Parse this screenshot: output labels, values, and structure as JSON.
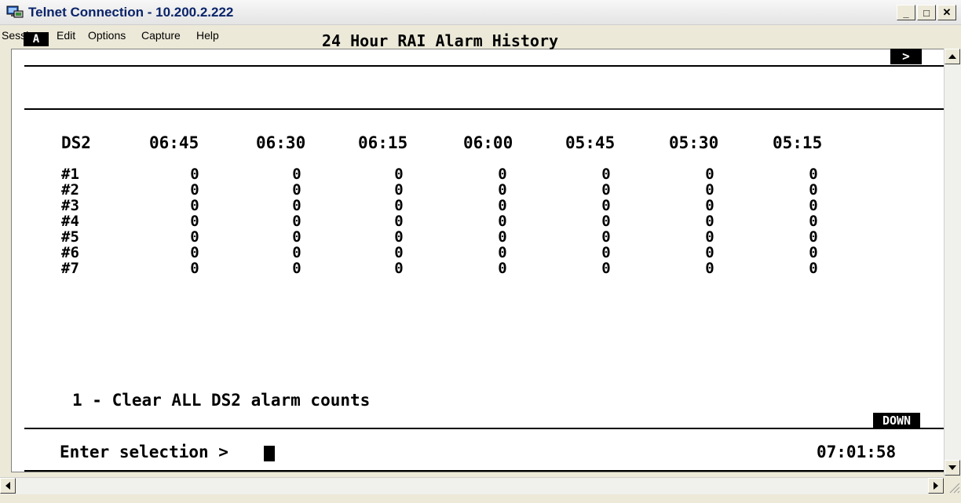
{
  "window": {
    "title": "Telnet Connection - 10.200.2.222",
    "minimize_label": "_",
    "maximize_label": "□",
    "close_label": "✕"
  },
  "menu": [
    "Session",
    "Edit",
    "Options",
    "Capture",
    "Help"
  ],
  "screen": {
    "id_label": "A",
    "title": "24 Hour RAI Alarm History",
    "next_label": ">",
    "columns": [
      "DS2",
      "06:45",
      "06:30",
      "06:15",
      "06:00",
      "05:45",
      "05:30",
      "05:15"
    ],
    "rows": [
      {
        "label": "#1",
        "values": [
          "0",
          "0",
          "0",
          "0",
          "0",
          "0",
          "0"
        ]
      },
      {
        "label": "#2",
        "values": [
          "0",
          "0",
          "0",
          "0",
          "0",
          "0",
          "0"
        ]
      },
      {
        "label": "#3",
        "values": [
          "0",
          "0",
          "0",
          "0",
          "0",
          "0",
          "0"
        ]
      },
      {
        "label": "#4",
        "values": [
          "0",
          "0",
          "0",
          "0",
          "0",
          "0",
          "0"
        ]
      },
      {
        "label": "#5",
        "values": [
          "0",
          "0",
          "0",
          "0",
          "0",
          "0",
          "0"
        ]
      },
      {
        "label": "#6",
        "values": [
          "0",
          "0",
          "0",
          "0",
          "0",
          "0",
          "0"
        ]
      },
      {
        "label": "#7",
        "values": [
          "0",
          "0",
          "0",
          "0",
          "0",
          "0",
          "0"
        ]
      }
    ],
    "option_1": "1 - Clear ALL DS2 alarm counts",
    "down_label": "DOWN",
    "prompt": "Enter selection >",
    "clock": "07:01:58"
  },
  "icons": {
    "app": "telnet-icon",
    "scroll_up": "arrow-up-icon",
    "scroll_down": "arrow-down-icon",
    "scroll_left": "arrow-left-icon",
    "scroll_right": "arrow-right-icon"
  }
}
